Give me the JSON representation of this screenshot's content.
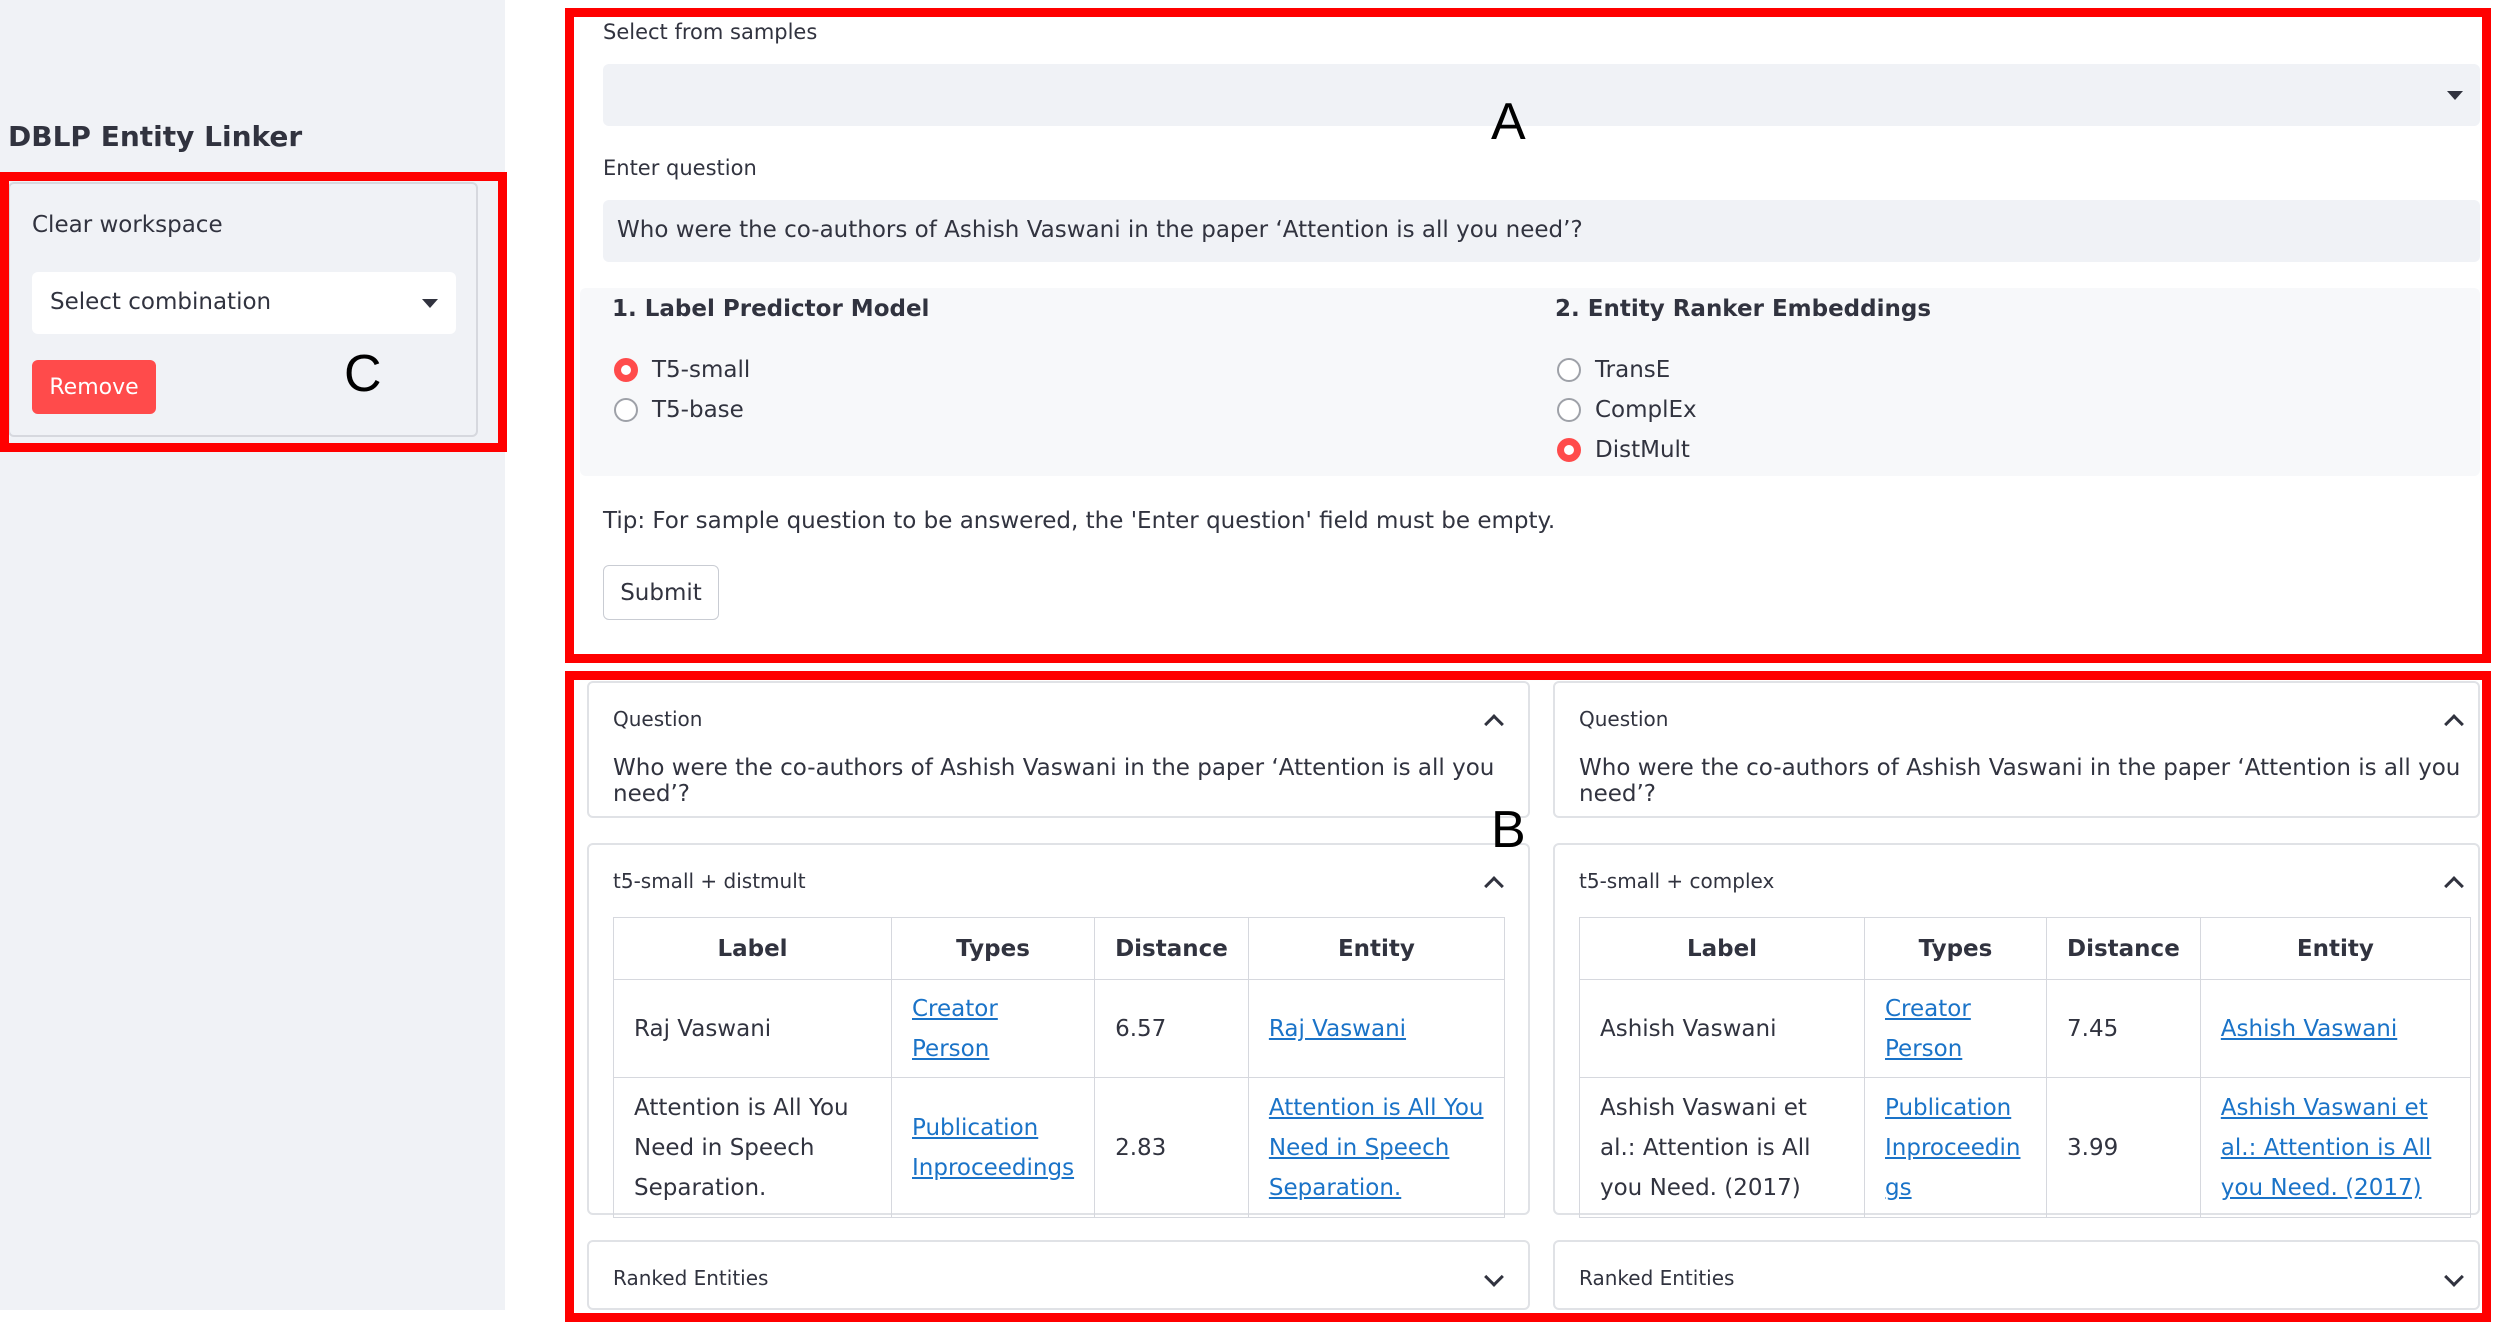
{
  "sidebar": {
    "title": "DBLP Entity Linker",
    "clear_label": "Clear workspace",
    "select_placeholder": "Select combination",
    "remove_label": "Remove"
  },
  "form": {
    "samples_label": "Select from samples",
    "samples_value": "",
    "question_label": "Enter question",
    "question_value": "Who were the co-authors of Ashish Vaswani in the paper ‘Attention is all you need’?",
    "model_group": {
      "title": "1. Label Predictor Model",
      "options": [
        "T5-small",
        "T5-base"
      ],
      "selected": "T5-small"
    },
    "embed_group": {
      "title": "2. Entity Ranker Embeddings",
      "options": [
        "TransE",
        "ComplEx",
        "DistMult"
      ],
      "selected": "DistMult"
    },
    "tip": "Tip: For sample question to be answered, the 'Enter question' field must be empty.",
    "submit_label": "Submit"
  },
  "results": {
    "left": {
      "question_header": "Question",
      "question_text": "Who were the co-authors of Ashish Vaswani in the paper ‘Attention is all you need’?",
      "combo_header": "t5-small + distmult",
      "columns": [
        "Label",
        "Types",
        "Distance",
        "Entity"
      ],
      "rows": [
        {
          "label": "Raj Vaswani",
          "types": [
            "Creator",
            "Person"
          ],
          "distance": "6.57",
          "entity": "Raj Vaswani"
        },
        {
          "label": "Attention is All You Need in Speech Separation.",
          "types": [
            "Publication",
            "Inproceedings"
          ],
          "distance": "2.83",
          "entity": "Attention is All You Need in Speech Separation."
        }
      ],
      "ranked_header": "Ranked Entities"
    },
    "right": {
      "question_header": "Question",
      "question_text": "Who were the co-authors of Ashish Vaswani in the paper ‘Attention is all you need’?",
      "combo_header": "t5-small + complex",
      "columns": [
        "Label",
        "Types",
        "Distance",
        "Entity"
      ],
      "rows": [
        {
          "label": "Ashish Vaswani",
          "types": [
            "Creator",
            "Person"
          ],
          "distance": "7.45",
          "entity": "Ashish Vaswani"
        },
        {
          "label": "Ashish Vaswani et al.: Attention is All you Need. (2017)",
          "types": [
            "Publication",
            "Inproceedings"
          ],
          "distance": "3.99",
          "entity": "Ashish Vaswani et al.: Attention is All you Need. (2017)"
        }
      ],
      "ranked_header": "Ranked Entities"
    }
  },
  "annotations": {
    "a": "A",
    "b": "B",
    "c": "C"
  },
  "colors": {
    "accent": "#ff4b4b",
    "highlight": "#ff0000",
    "link": "#1a73c8"
  }
}
